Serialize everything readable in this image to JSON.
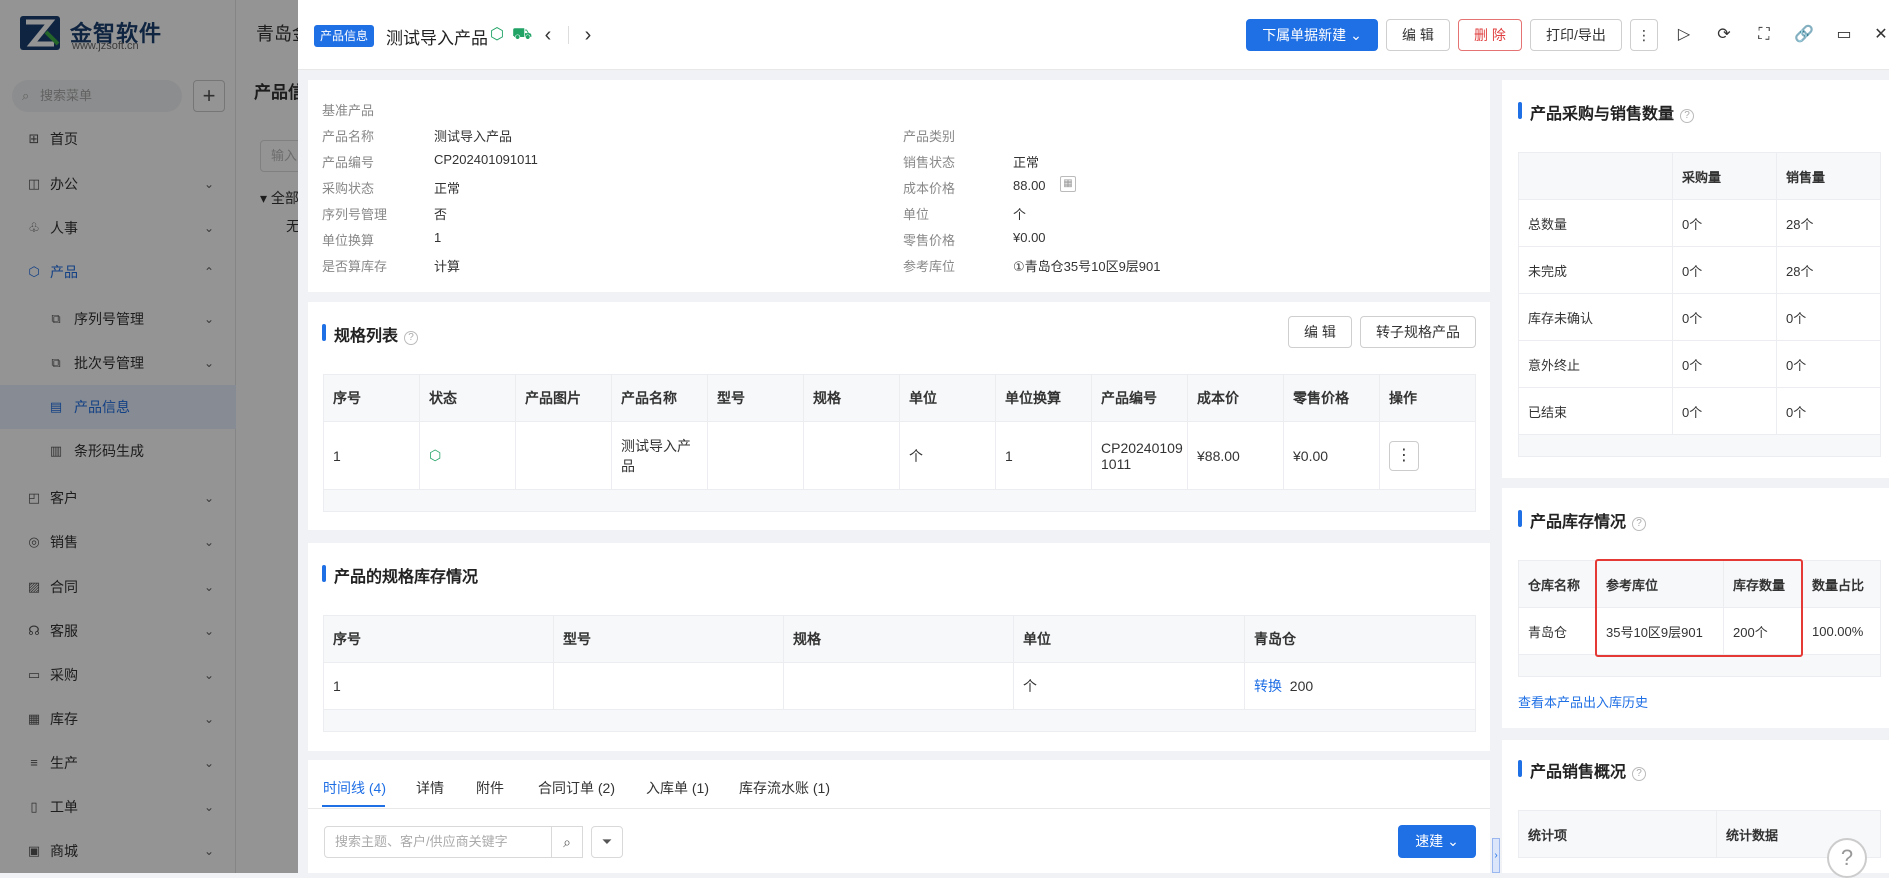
{
  "sidebar": {
    "logo_cn": "金智软件",
    "logo_en": "www.jzsoft.cn",
    "search_placeholder": "搜索菜单",
    "add_label": "+",
    "items": [
      {
        "label": "首页",
        "icon": "⊞"
      },
      {
        "label": "办公",
        "icon": "◫"
      },
      {
        "label": "人事",
        "icon": "♧"
      },
      {
        "label": "产品",
        "icon": "⬡"
      },
      {
        "label": "序列号管理",
        "icon": "⧉"
      },
      {
        "label": "批次号管理",
        "icon": "⧉"
      },
      {
        "label": "产品信息",
        "icon": "▤"
      },
      {
        "label": "条形码生成",
        "icon": "▥"
      },
      {
        "label": "客户",
        "icon": "◰"
      },
      {
        "label": "销售",
        "icon": "◎"
      },
      {
        "label": "合同",
        "icon": "▨"
      },
      {
        "label": "客服",
        "icon": "☊"
      },
      {
        "label": "采购",
        "icon": "▭"
      },
      {
        "label": "库存",
        "icon": "▦"
      },
      {
        "label": "生产",
        "icon": "≡"
      },
      {
        "label": "工单",
        "icon": "▯"
      },
      {
        "label": "商城",
        "icon": "▣"
      }
    ]
  },
  "background": {
    "title": "青岛金",
    "subtitle": "产品信",
    "input_placeholder": "输入",
    "tree_root": "全部",
    "tree_child": "无"
  },
  "drawer": {
    "tag": "产品信息",
    "title": "测试导入产品",
    "buttons": {
      "new": "下属单据新建",
      "edit": "编 辑",
      "delete": "删 除",
      "print": "打印/导出",
      "more": "⋮"
    }
  },
  "basic": {
    "heading": "基准产品",
    "left": [
      {
        "label": "产品名称",
        "value": "测试导入产品"
      },
      {
        "label": "产品编号",
        "value": "CP202401091011"
      },
      {
        "label": "采购状态",
        "value": "正常"
      },
      {
        "label": "序列号管理",
        "value": "否"
      },
      {
        "label": "单位换算",
        "value": "1"
      },
      {
        "label": "是否算库存",
        "value": "计算"
      }
    ],
    "right": [
      {
        "label": "产品类别",
        "value": ""
      },
      {
        "label": "销售状态",
        "value": "正常"
      },
      {
        "label": "成本价格",
        "value": "88.00"
      },
      {
        "label": "单位",
        "value": "个"
      },
      {
        "label": "零售价格",
        "value": "¥0.00"
      },
      {
        "label": "参考库位",
        "value": "①青岛仓35号10区9层901"
      }
    ]
  },
  "spec": {
    "title": "规格列表",
    "edit": "编 辑",
    "convert": "转子规格产品",
    "headers": [
      "序号",
      "状态",
      "产品图片",
      "产品名称",
      "型号",
      "规格",
      "单位",
      "单位换算",
      "产品编号",
      "成本价",
      "零售价格",
      "操作"
    ],
    "row": {
      "no": "1",
      "name_l1": "测试导入产",
      "name_l2": "品",
      "model": "",
      "spec": "",
      "unit": "个",
      "conv": "1",
      "code_l1": "CP20240109",
      "code_l2": "1011",
      "cost": "¥88.00",
      "retail": "¥0.00"
    }
  },
  "spec_stock": {
    "title": "产品的规格库存情况",
    "headers": [
      "序号",
      "型号",
      "规格",
      "单位",
      "青岛仓"
    ],
    "row": {
      "no": "1",
      "model": "",
      "spec": "",
      "unit": "个",
      "convert": "转换",
      "qty": "200"
    }
  },
  "tabs": [
    {
      "label": "时间线 (4)"
    },
    {
      "label": "详情"
    },
    {
      "label": "附件"
    },
    {
      "label": "合同订单 (2)"
    },
    {
      "label": "入库单 (1)"
    },
    {
      "label": "库存流水账 (1)"
    }
  ],
  "timeline": {
    "search_placeholder": "搜索主题、客户/供应商关键字",
    "quick": "速建"
  },
  "purchase_sales": {
    "title": "产品采购与销售数量",
    "headers": [
      "",
      "采购量",
      "销售量"
    ],
    "rows": [
      {
        "label": "总数量",
        "purchase": "0个",
        "sales": "28个"
      },
      {
        "label": "未完成",
        "purchase": "0个",
        "sales": "28个"
      },
      {
        "label": "库存未确认",
        "purchase": "0个",
        "sales": "0个"
      },
      {
        "label": "意外终止",
        "purchase": "0个",
        "sales": "0个"
      },
      {
        "label": "已结束",
        "purchase": "0个",
        "sales": "0个"
      }
    ]
  },
  "inventory": {
    "title": "产品库存情况",
    "headers": [
      "仓库名称",
      "参考库位",
      "库存数量",
      "数量占比"
    ],
    "row": {
      "warehouse": "青岛仓",
      "location": "35号10区9层901",
      "qty": "200个",
      "ratio": "100.00%"
    },
    "history_link": "查看本产品出入库历史"
  },
  "sales_overview": {
    "title": "产品销售概况",
    "headers": [
      "统计项",
      "统计数据"
    ]
  },
  "colors": {
    "accent": "#1f6fe5",
    "danger": "#e53935",
    "success": "#21a366"
  }
}
